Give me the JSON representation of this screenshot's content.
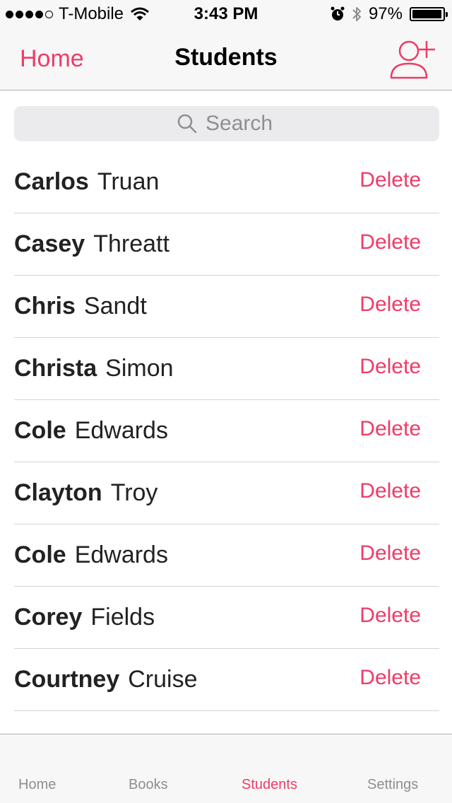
{
  "status_bar": {
    "carrier": "T-Mobile",
    "time": "3:43 PM",
    "battery": "97%",
    "battery_level": 0.97
  },
  "nav": {
    "back_label": "Home",
    "title": "Students",
    "add_icon": "add-user-icon"
  },
  "search": {
    "placeholder": "Search",
    "value": ""
  },
  "students": [
    {
      "first": "Carlos",
      "last": "Truan",
      "action": "Delete"
    },
    {
      "first": "Casey",
      "last": "Threatt",
      "action": "Delete"
    },
    {
      "first": "Chris",
      "last": "Sandt",
      "action": "Delete"
    },
    {
      "first": "Christa",
      "last": "Simon",
      "action": "Delete"
    },
    {
      "first": "Cole",
      "last": "Edwards",
      "action": "Delete"
    },
    {
      "first": "Clayton",
      "last": "Troy",
      "action": "Delete"
    },
    {
      "first": "Cole",
      "last": "Edwards",
      "action": "Delete"
    },
    {
      "first": "Corey",
      "last": "Fields",
      "action": "Delete"
    },
    {
      "first": "Courtney",
      "last": "Cruise",
      "action": "Delete"
    }
  ],
  "tabs": [
    {
      "label": "Home",
      "active": false
    },
    {
      "label": "Books",
      "active": false
    },
    {
      "label": "Students",
      "active": true
    },
    {
      "label": "Settings",
      "active": false
    }
  ],
  "colors": {
    "accent": "#ef3b67",
    "bar_background": "#f7f7f7",
    "search_background": "#ebebed"
  }
}
